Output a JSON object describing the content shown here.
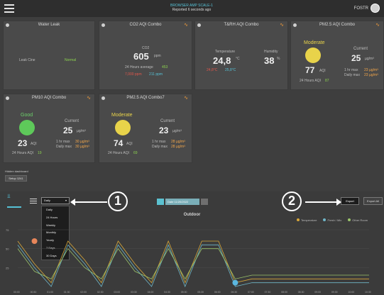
{
  "topbar": {
    "device_name": "BROWSER AMP SCALE-1",
    "reported": "Reported 6 seconds ago",
    "user": "FOSTR",
    "colors": {
      "accent": "#56c1d6"
    }
  },
  "cards": {
    "water_leak": {
      "title": "Water Leak",
      "left_label": "Leak Cine",
      "right_label": "Normal"
    },
    "co2": {
      "title": "CO2 AQI Combo",
      "sub": "CO2",
      "value": "605",
      "unit": "ppm",
      "avg_label": "24 Hours average",
      "avg_value": "453",
      "min_value": "7,000 ppm",
      "max_value": "211 ppm"
    },
    "trh": {
      "title": "T&RH AQI Combo",
      "temp_label": "Temperature",
      "hum_label": "Humidity",
      "temp_value": "24,8",
      "temp_unit": "°C",
      "hum_value": "38",
      "hum_unit": "%",
      "temp_min": "24,8°C",
      "temp_max": "25,8°C"
    },
    "pm25": {
      "title": "PM2.5 AQI Combo",
      "status": "Moderate",
      "aqi": "77",
      "aqi_unit": "AQI",
      "h24_label": "24 Hours AQI",
      "h24_value": "87",
      "current_label": "Current",
      "current_value": "25",
      "current_unit": "µg/m³",
      "hr_label": "1 hr max",
      "hr_value": "23 µg/m³",
      "daily_label": "Daily max",
      "daily_value": "23 µg/m³"
    },
    "pm10": {
      "title": "PM10 AQI Combo",
      "status": "Good",
      "aqi": "23",
      "aqi_unit": "AQI",
      "h24_label": "24 Hours AQI",
      "h24_value": "19",
      "current_label": "Current",
      "current_value": "25",
      "current_unit": "µg/m³",
      "hr_label": "1 hr max",
      "hr_value": "30 µg/m³",
      "daily_label": "Daily max",
      "daily_value": "30 µg/m³"
    },
    "pm25b": {
      "title": "PM2.5 AQI Combo7",
      "status": "Moderate",
      "aqi": "74",
      "aqi_unit": "AQI",
      "h24_label": "24 Hours AQI",
      "h24_value": "69",
      "current_label": "Current",
      "current_value": "23",
      "current_unit": "µg/m³",
      "hr_label": "1 hr max",
      "hr_value": "28 µg/m³",
      "daily_label": "Daily max",
      "daily_value": "28 µg/m³"
    }
  },
  "dashboard": {
    "hidden_label": "Hidden dashboard",
    "setup_button": "Setup 1241"
  },
  "chart_toolbar": {
    "period_selected": "Daily",
    "period_options": [
      "Daily",
      "24 Hours",
      "Weekly",
      "Monthly",
      "Yearly",
      "7 Days",
      "30 Days"
    ],
    "date_value": "Date 11/20/2022",
    "export_label": "Export",
    "export_all_label": "Export All"
  },
  "callouts": {
    "one": "1",
    "two": "2"
  },
  "chart_data": {
    "type": "line",
    "title": "Outdoor",
    "legend": [
      "Temperature",
      "Fresh / Mix",
      "Other Room"
    ],
    "colors": [
      "#d9a83a",
      "#6fb6c8",
      "#9cc56b"
    ],
    "x": [
      "00:00",
      "00:30",
      "01:00",
      "01:30",
      "02:00",
      "02:30",
      "03:00",
      "03:30",
      "04:00",
      "04:30",
      "05:00",
      "05:30",
      "06:00",
      "06:30",
      "07:00",
      "07:30",
      "08:00",
      "08:30",
      "09:00",
      "09:30",
      "10:00",
      "10:30"
    ],
    "y_ticks": [
      "75",
      "50",
      "25"
    ],
    "series": [
      {
        "name": "Temperature",
        "values": [
          60,
          30,
          5,
          60,
          35,
          5,
          60,
          30,
          5,
          60,
          5,
          60,
          60,
          5,
          10,
          10,
          10,
          10,
          10,
          10,
          10,
          10
        ]
      },
      {
        "name": "Fresh / Mix",
        "values": [
          55,
          25,
          0,
          55,
          30,
          0,
          55,
          25,
          0,
          55,
          0,
          55,
          55,
          0,
          5,
          5,
          5,
          5,
          5,
          5,
          5,
          5
        ]
      },
      {
        "name": "Other Room",
        "values": [
          50,
          20,
          10,
          50,
          25,
          10,
          50,
          20,
          10,
          50,
          10,
          50,
          50,
          10,
          15,
          15,
          15,
          15,
          15,
          15,
          15,
          15
        ]
      }
    ],
    "markers": [
      {
        "x": "00:30",
        "value": 60,
        "color": "#e8865a"
      },
      {
        "x": "06:30",
        "value": 5,
        "color": "#5bb7e0"
      }
    ]
  }
}
